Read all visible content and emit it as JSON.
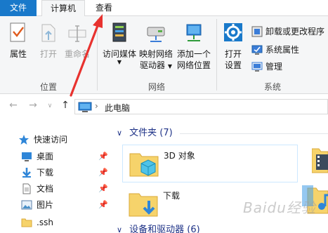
{
  "ribbon_tabs": {
    "file": "文件",
    "computer": "计算机",
    "view": "查看"
  },
  "location_group": {
    "label": "位置",
    "properties": "属性",
    "open": "打开",
    "rename": "重命名"
  },
  "network_group": {
    "label": "网络",
    "access_media": "访问媒体",
    "map_drive_line1": "映射网络",
    "map_drive_line2": "驱动器",
    "add_location_line1": "添加一个",
    "add_location_line2": "网络位置"
  },
  "system_group": {
    "label": "系统",
    "open_settings_line1": "打开",
    "open_settings_line2": "设置",
    "uninstall": "卸载或更改程序",
    "system_properties": "系统属性",
    "manage": "管理"
  },
  "address_bar": {
    "path": "此电脑"
  },
  "nav_pane": {
    "quick_access": "快速访问",
    "items": [
      {
        "label": "桌面",
        "pinned": true
      },
      {
        "label": "下载",
        "pinned": true
      },
      {
        "label": "文档",
        "pinned": true
      },
      {
        "label": "图片",
        "pinned": true
      },
      {
        "label": ".ssh",
        "pinned": false
      }
    ],
    "pin_glyph": "📌"
  },
  "content": {
    "folders_header": "文件夹 (7)",
    "folders": [
      {
        "label": "3D 对象"
      },
      {
        "label": "下载"
      }
    ],
    "devices_header": "设备和驱动器 (6)"
  },
  "watermark": "Baidu经验",
  "colors": {
    "file_tab": "#1979ca",
    "section_header": "#1e3287",
    "annotation_arrow": "#e8322f"
  }
}
